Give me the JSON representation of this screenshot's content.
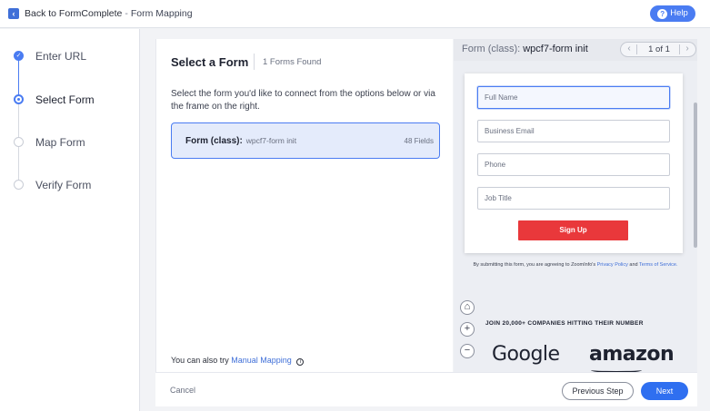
{
  "topbar": {
    "back_label": "Back to FormComplete",
    "separator": "-",
    "page_name": "Form Mapping",
    "help_label": "Help"
  },
  "steps": [
    {
      "label": "Enter URL",
      "state": "done"
    },
    {
      "label": "Select Form",
      "state": "current"
    },
    {
      "label": "Map Form",
      "state": "pending"
    },
    {
      "label": "Verify Form",
      "state": "pending"
    }
  ],
  "main": {
    "title": "Select a Form",
    "forms_found": "1 Forms Found",
    "description": "Select the form you'd like to connect from the options below or via the frame on the right.",
    "form_option": {
      "label": "Form (class):",
      "name": "wpcf7-form init",
      "fields": "48 Fields"
    },
    "manual_prefix": "You can also try",
    "manual_link": "Manual Mapping"
  },
  "footer": {
    "cancel_label": "Cancel",
    "previous_label": "Previous Step",
    "next_label": "Next"
  },
  "preview": {
    "title_prefix": "Form (class):",
    "form_name": "wpcf7-form init",
    "pager": "1 of 1",
    "inputs": [
      {
        "placeholder": "Full Name"
      },
      {
        "placeholder": "Business Email"
      },
      {
        "placeholder": "Phone"
      },
      {
        "placeholder": "Job Title"
      }
    ],
    "submit_label": "Sign Up",
    "consent_text": "By submitting this form, you are agreeing to ZoomInfo's",
    "privacy_link": "Privacy Policy",
    "consent_and": "and",
    "terms_link": "Terms of Service.",
    "join_text": "JOIN 20,000+ COMPANIES HITTING THEIR NUMBER",
    "logos": [
      "Google",
      "amazon"
    ]
  },
  "colors": {
    "accent": "#4a7cf2",
    "next_button": "#2f6ff0",
    "signup_button": "#e9383b",
    "selected_form_bg": "#e4ebfb"
  }
}
